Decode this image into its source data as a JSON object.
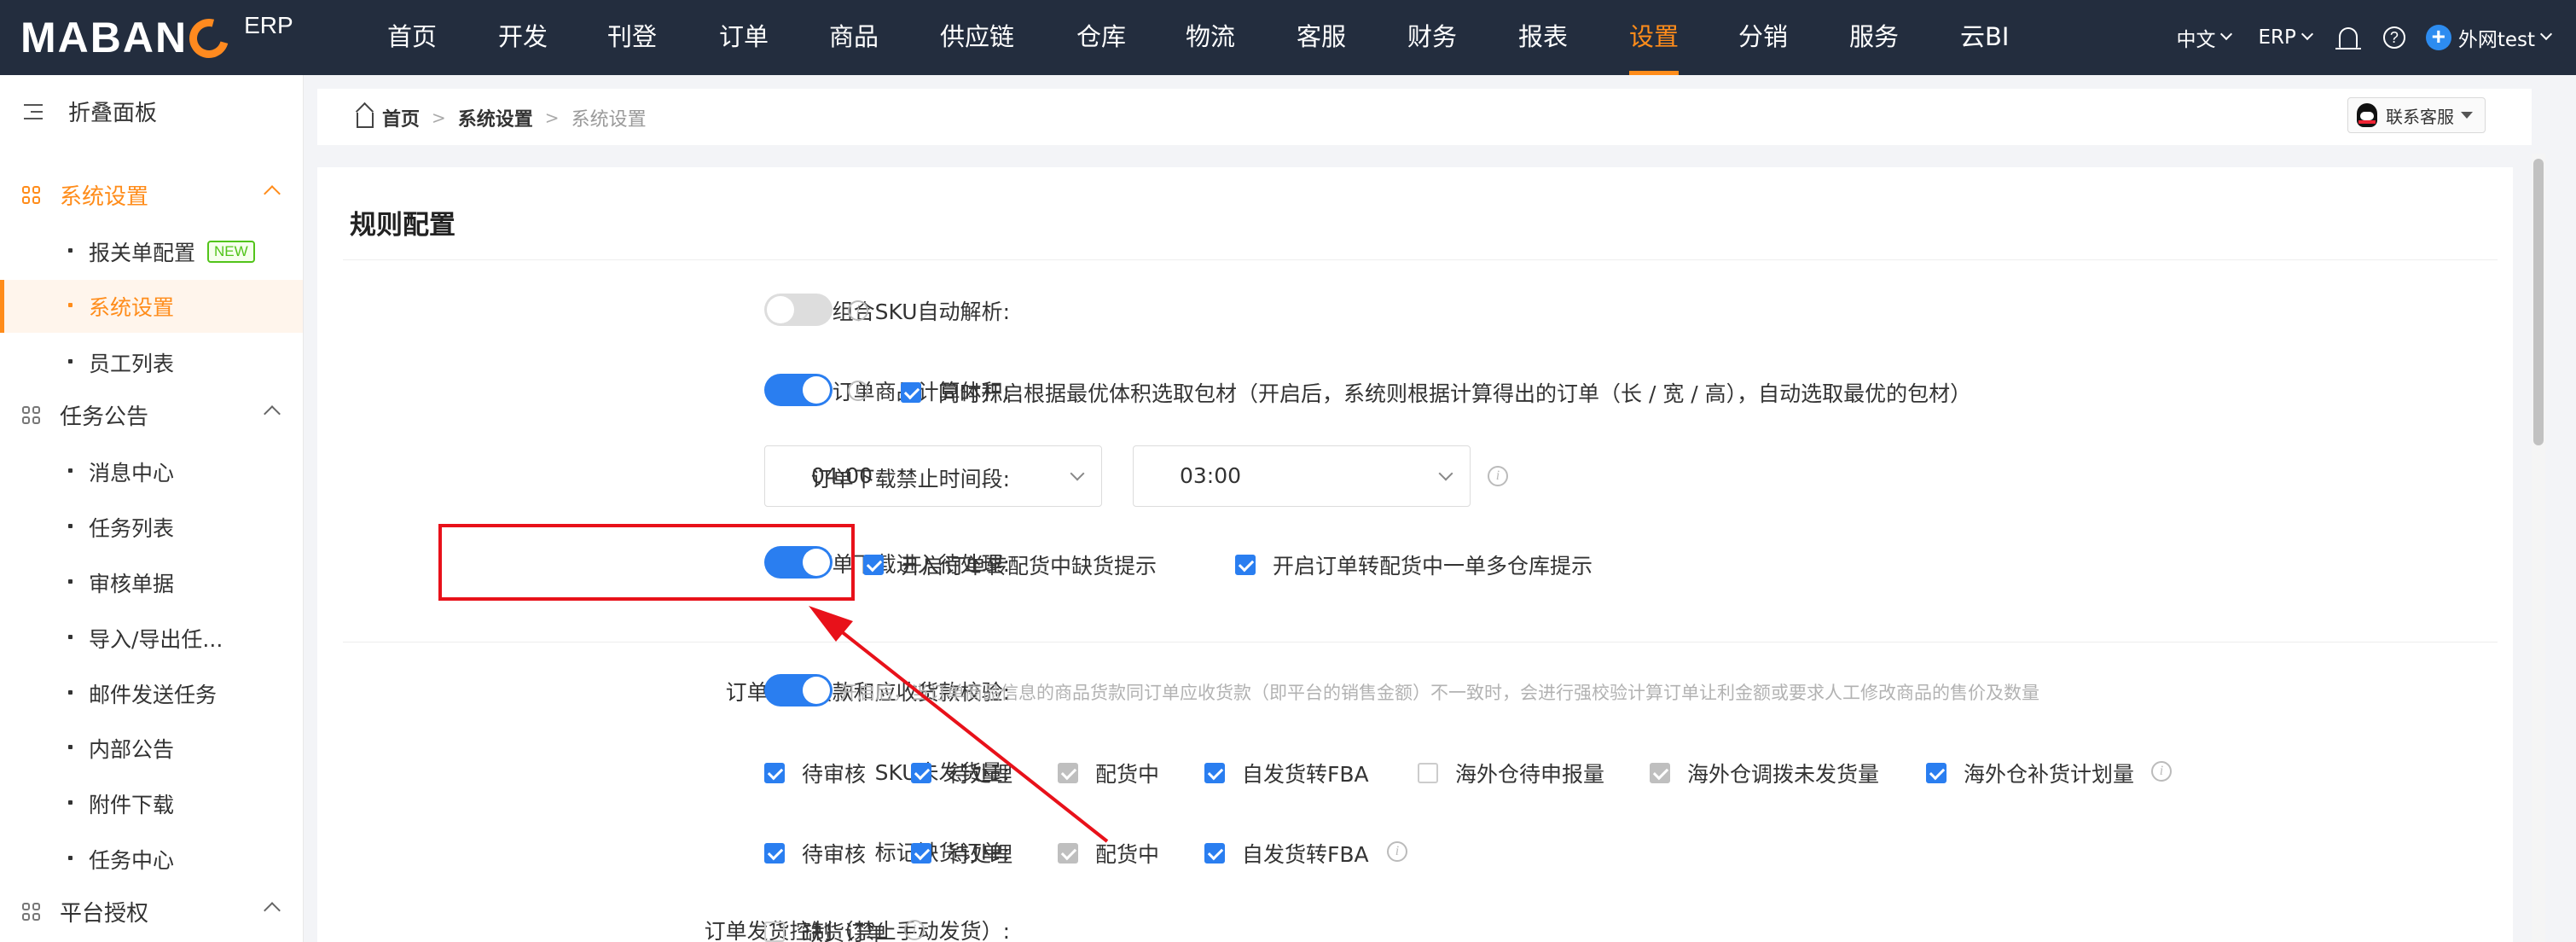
{
  "header": {
    "logo_text_a": "MABAN",
    "logo_text_b": "",
    "logo_erp": "ERP",
    "nav": [
      "首页",
      "开发",
      "刊登",
      "订单",
      "商品",
      "供应链",
      "仓库",
      "物流",
      "客服",
      "财务",
      "报表",
      "设置",
      "分销",
      "服务",
      "云BI"
    ],
    "active_nav": "设置",
    "lang": "中文",
    "product": "ERP",
    "user": "外网test",
    "accent_color": "#ff8c1a"
  },
  "sidebar": {
    "collapse_label": "折叠面板",
    "sections": [
      {
        "label": "系统设置",
        "items": [
          "报关单配置",
          "系统设置",
          "员工列表"
        ]
      },
      {
        "label": "任务公告",
        "items": [
          "消息中心",
          "任务列表",
          "审核单据",
          "导入/导出任...",
          "邮件发送任务",
          "内部公告",
          "附件下载",
          "任务中心"
        ]
      },
      {
        "label": "平台授权",
        "items": []
      }
    ],
    "new_badge": "NEW",
    "active_item": "系统设置"
  },
  "breadcrumb": {
    "home": "首页",
    "level1": "系统设置",
    "current": "系统设置"
  },
  "contact_button": "联系客服",
  "panel": {
    "title": "规则配置",
    "rows": {
      "combo_sku": {
        "label": "组合SKU自动解析:",
        "enabled": false
      },
      "volume": {
        "label": "订单商品计算体积:",
        "enabled": true,
        "checkbox": "同时开启根据最优体积选取包材（开启后，系统则根据计算得出的订单（长 / 宽 / 高），自动选取最优的包材）"
      },
      "download_window": {
        "label": "订单下载禁止时间段:",
        "start": "04:00",
        "end": "03:00"
      },
      "pending": {
        "label": "订单下载进入待处理:",
        "enabled": true,
        "cb1": "开启订单转配货中缺货提示",
        "cb2": "开启订单转配货中一单多仓库提示"
      },
      "payment_check": {
        "label": "订单商品货款和应收货款校验:",
        "enabled": true,
        "hint": "开启后，当订单商品信息的商品货款同订单应收货款（即平台的销售金额）不一致时，会进行强校验计算订单让利金额或要求人工修改商品的售价及数量"
      },
      "sku_unshipped": {
        "label": "SKU未发货量:",
        "options": [
          "待审核",
          "待处理",
          "配货中",
          "自发货转FBA",
          "海外仓待申报量",
          "海外仓调拨未发货量",
          "海外仓补货计划量"
        ]
      },
      "mark_oos": {
        "label": "标记缺货订单:",
        "options": [
          "待审核",
          "待处理",
          "配货中",
          "自发货转FBA"
        ]
      },
      "ship_control": {
        "label": "订单发货控制（禁止手动发货）:",
        "options": [
          "缺货订单"
        ]
      }
    }
  }
}
